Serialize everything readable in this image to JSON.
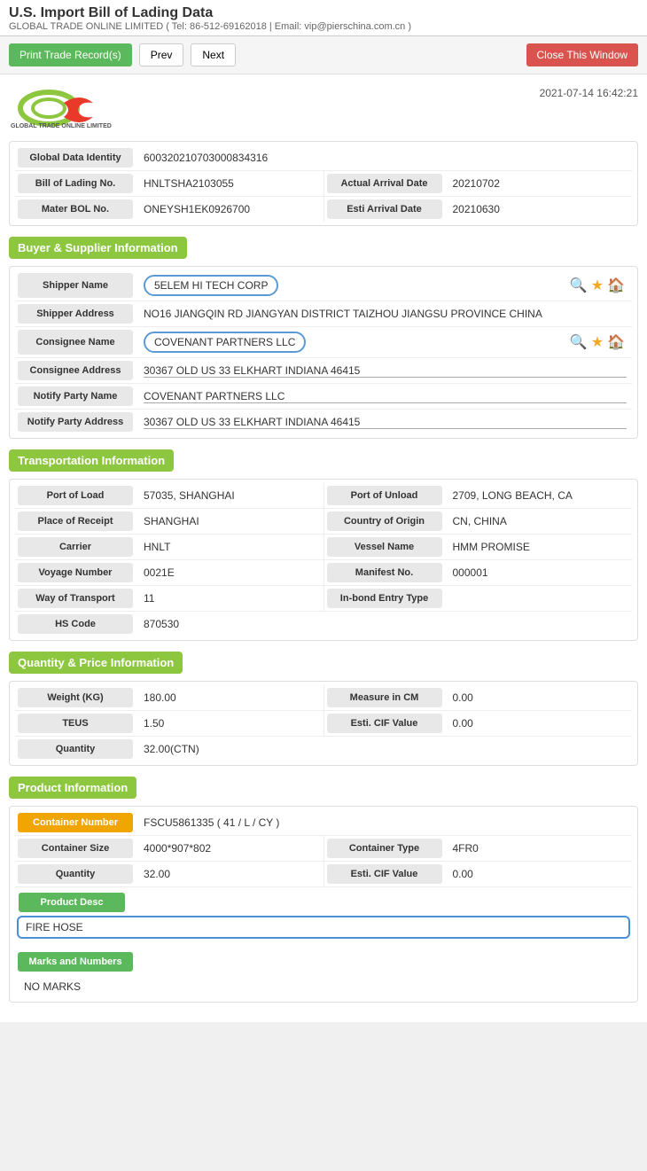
{
  "page": {
    "title": "U.S. Import Bill of Lading Data",
    "subtitle": "GLOBAL TRADE ONLINE LIMITED ( Tel: 86-512-69162018 | Email: vip@pierschina.com.cn )",
    "timestamp": "2021-07-14 16:42:21"
  },
  "toolbar": {
    "print_label": "Print Trade Record(s)",
    "prev_label": "Prev",
    "next_label": "Next",
    "close_label": "Close This Window"
  },
  "identity": {
    "label": "Global Data Identity",
    "value": "600320210703000834316"
  },
  "bol": {
    "no_label": "Bill of Lading No.",
    "no_value": "HNLTSHA2103055",
    "actual_label": "Actual Arrival Date",
    "actual_value": "20210702",
    "master_label": "Mater BOL No.",
    "master_value": "ONEYSH1EK0926700",
    "esti_label": "Esti Arrival Date",
    "esti_value": "20210630"
  },
  "buyer_supplier": {
    "section_title": "Buyer & Supplier Information",
    "shipper_name_label": "Shipper Name",
    "shipper_name_value": "5ELEM HI TECH CORP",
    "shipper_address_label": "Shipper Address",
    "shipper_address_value": "NO16 JIANGQIN RD JIANGYAN DISTRICT TAIZHOU JIANGSU PROVINCE CHINA",
    "consignee_name_label": "Consignee Name",
    "consignee_name_value": "COVENANT PARTNERS LLC",
    "consignee_address_label": "Consignee Address",
    "consignee_address_value": "30367 OLD US 33 ELKHART INDIANA 46415",
    "notify_name_label": "Notify Party Name",
    "notify_name_value": "COVENANT PARTNERS LLC",
    "notify_address_label": "Notify Party Address",
    "notify_address_value": "30367 OLD US 33 ELKHART INDIANA 46415"
  },
  "transport": {
    "section_title": "Transportation Information",
    "port_load_label": "Port of Load",
    "port_load_value": "57035, SHANGHAI",
    "port_unload_label": "Port of Unload",
    "port_unload_value": "2709, LONG BEACH, CA",
    "place_receipt_label": "Place of Receipt",
    "place_receipt_value": "SHANGHAI",
    "country_origin_label": "Country of Origin",
    "country_origin_value": "CN, CHINA",
    "carrier_label": "Carrier",
    "carrier_value": "HNLT",
    "vessel_label": "Vessel Name",
    "vessel_value": "HMM PROMISE",
    "voyage_label": "Voyage Number",
    "voyage_value": "0021E",
    "manifest_label": "Manifest No.",
    "manifest_value": "000001",
    "way_label": "Way of Transport",
    "way_value": "11",
    "inbond_label": "In-bond Entry Type",
    "inbond_value": "",
    "hs_label": "HS Code",
    "hs_value": "870530"
  },
  "quantity_price": {
    "section_title": "Quantity & Price Information",
    "weight_label": "Weight (KG)",
    "weight_value": "180.00",
    "measure_label": "Measure in CM",
    "measure_value": "0.00",
    "teus_label": "TEUS",
    "teus_value": "1.50",
    "esti_cif_label": "Esti. CIF Value",
    "esti_cif_value": "0.00",
    "quantity_label": "Quantity",
    "quantity_value": "32.00(CTN)"
  },
  "product": {
    "section_title": "Product Information",
    "container_number_label": "Container Number",
    "container_number_value": "FSCU5861335 ( 41 / L / CY )",
    "container_size_label": "Container Size",
    "container_size_value": "4000*907*802",
    "container_type_label": "Container Type",
    "container_type_value": "4FR0",
    "quantity_label": "Quantity",
    "quantity_value": "32.00",
    "esti_cif_label": "Esti. CIF Value",
    "esti_cif_value": "0.00",
    "product_desc_label": "Product Desc",
    "product_desc_value": "FIRE HOSE",
    "marks_label": "Marks and Numbers",
    "marks_value": "NO MARKS"
  },
  "icons": {
    "magnify": "🔍",
    "star": "★",
    "home": "🏠"
  }
}
